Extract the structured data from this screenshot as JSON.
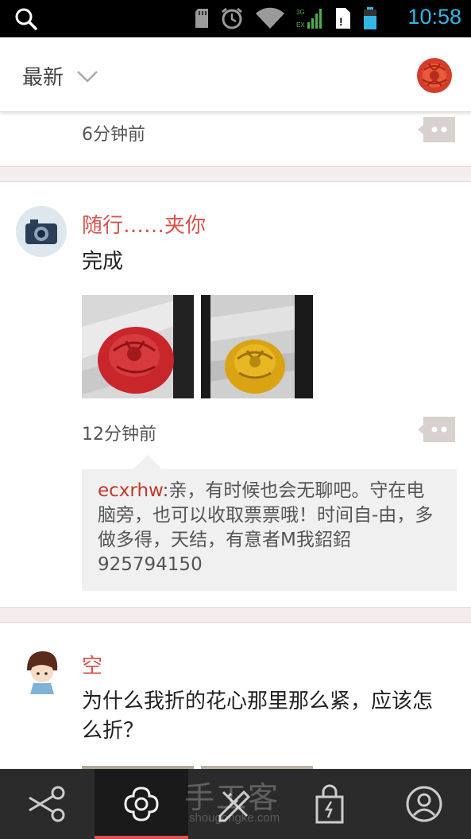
{
  "status_bar": {
    "time": "10:58",
    "icons": [
      "sd-card-icon",
      "alarm-icon",
      "wifi-icon",
      "signal-3g-icon",
      "sim-icon",
      "battery-icon"
    ],
    "signal_labels": [
      "3G",
      "EX"
    ]
  },
  "header": {
    "filter_label": "最新",
    "chevron": "chevron-down-icon"
  },
  "feed": {
    "partial_post": {
      "time": "6分钟前"
    },
    "posts": [
      {
        "username": "随行……夹你",
        "text": "完成",
        "photos": [
          "red-rose-photo",
          "yellow-rose-photo"
        ],
        "time": "12分钟前",
        "reply": {
          "author": "ecxrhw",
          "text": ":亲，有时候也会无聊吧。守在电脑旁，也可以收取票票哦！时间自-由，多做多得，天结，有意者M我鉊鉊925794150"
        }
      },
      {
        "username": "空",
        "text": "为什么我折的花心那里那么紧，应该怎么折？"
      }
    ]
  },
  "bottom_nav": {
    "items": [
      "scissors-icon",
      "flower-icon",
      "pencil-ruler-icon",
      "shopping-bag-icon",
      "profile-icon"
    ],
    "active_index": 1,
    "watermark": "手工客",
    "watermark_sub": "shougongke.com"
  },
  "colors": {
    "accent": "#d9534f",
    "status_time": "#33b5e5",
    "nav_bg": "#2b2b2b"
  }
}
